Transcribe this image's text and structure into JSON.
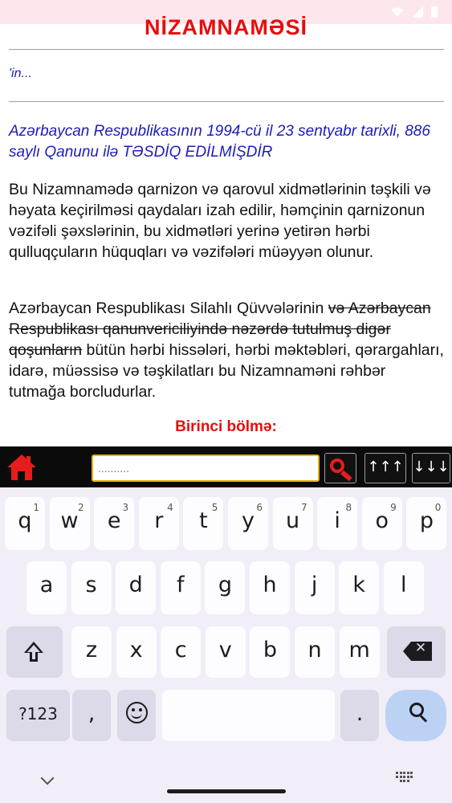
{
  "document": {
    "title": "NİZAMNAMƏSİ",
    "author": "'in...",
    "approval": "Azərbaycan Respublikasının 1994-cü il 23 sentyabr tarixli, 886 saylı Qanunu ilə TƏSDİQ EDİLMİŞDİR",
    "para1": "Bu Nizamnamədə qarnizon və qarovul xidmətlərinin təşkili və həyata keçirilməsi qaydaları izah edilir, həmçinin qarnizonun vəzifəli şəxslərinin, bu xidmətləri yerinə yetirən hərbi qulluqçuların hüquqları və vəzifələri müəyyən olunur.",
    "para2_start": "Azərbaycan Respublikası Silahlı Qüvvələrinin ",
    "para2_struck": "və Azərbaycan Respublikası qanunvericiliyində nəzərdə tutulmuş digər qoşunların",
    "para2_end": " bütün hərbi hissələri, hərbi məktəbləri, qərargahları, idarə, müəssisə və təşkilatları bu Nizamnaməni rəhbər tutmağa borcludurlar.",
    "section_heading": "Birinci bölmə:"
  },
  "toolbar": {
    "search_placeholder": "..........",
    "prev_label": "↑↑↑",
    "next_label": "↓↓↓",
    "icons": [
      "home-icon",
      "search-icon"
    ],
    "accent": "#e61d1d",
    "field_border": "#e6b400"
  },
  "keyboard": {
    "row1": [
      {
        "ch": "q",
        "hint": "1"
      },
      {
        "ch": "w",
        "hint": "2"
      },
      {
        "ch": "e",
        "hint": "3"
      },
      {
        "ch": "r",
        "hint": "4"
      },
      {
        "ch": "t",
        "hint": "5"
      },
      {
        "ch": "y",
        "hint": "6"
      },
      {
        "ch": "u",
        "hint": "7"
      },
      {
        "ch": "i",
        "hint": "8"
      },
      {
        "ch": "o",
        "hint": "9"
      },
      {
        "ch": "p",
        "hint": "0"
      }
    ],
    "row2": [
      "a",
      "s",
      "d",
      "f",
      "g",
      "h",
      "j",
      "k",
      "l"
    ],
    "row3": [
      "z",
      "x",
      "c",
      "v",
      "b",
      "n",
      "m"
    ],
    "symbols_label": "?123",
    "comma_label": ",",
    "period_label": ".",
    "enter_icon": "search-icon"
  }
}
